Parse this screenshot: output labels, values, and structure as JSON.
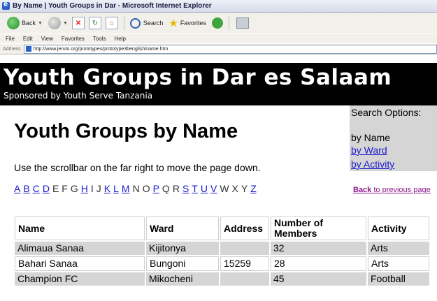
{
  "window": {
    "title": "By Name | Youth Groups in Dar - Microsoft Internet Explorer"
  },
  "toolbar": {
    "back_label": "Back",
    "search_label": "Search",
    "favorites_label": "Favorites"
  },
  "menu": [
    "File",
    "Edit",
    "View",
    "Favorites",
    "Tools",
    "Help"
  ],
  "address": {
    "label": "Address",
    "url": "http://www.jeruto.org/prototypes/prototype3benglish/name.htm"
  },
  "banner": {
    "title": "Youth Groups in Dar es Salaam",
    "sponsor": "Sponsored by Youth Serve Tanzania"
  },
  "page": {
    "heading": "Youth Groups by Name",
    "instruction": "Use the scrollbar on the far right to move the page down.",
    "letters": [
      {
        "l": "A",
        "link": true
      },
      {
        "l": "B",
        "link": true
      },
      {
        "l": "C",
        "link": true
      },
      {
        "l": "D",
        "link": true
      },
      {
        "l": "E",
        "link": false
      },
      {
        "l": "F",
        "link": false
      },
      {
        "l": "G",
        "link": false
      },
      {
        "l": "H",
        "link": true
      },
      {
        "l": "I",
        "link": false
      },
      {
        "l": "J",
        "link": false
      },
      {
        "l": "K",
        "link": true
      },
      {
        "l": "L",
        "link": true
      },
      {
        "l": "M",
        "link": true
      },
      {
        "l": "N",
        "link": false
      },
      {
        "l": "O",
        "link": false
      },
      {
        "l": "P",
        "link": true
      },
      {
        "l": "Q",
        "link": false
      },
      {
        "l": "R",
        "link": false
      },
      {
        "l": "S",
        "link": true
      },
      {
        "l": "T",
        "link": true
      },
      {
        "l": "U",
        "link": true
      },
      {
        "l": "V",
        "link": true
      },
      {
        "l": "W",
        "link": false
      },
      {
        "l": "X",
        "link": false
      },
      {
        "l": "Y",
        "link": false
      },
      {
        "l": "Z",
        "link": true
      }
    ]
  },
  "search_options": {
    "title": "Search Options:",
    "current": "by Name",
    "ward_link": "by Ward",
    "activity_link": "by Activity"
  },
  "back": {
    "bold": "Back",
    "rest": " to previous page"
  },
  "table": {
    "headers": [
      "Name",
      "Ward",
      "Address",
      "Number of Members",
      "Activity"
    ],
    "rows": [
      [
        "Alimaua Sanaa",
        "Kijitonya",
        "",
        "32",
        "Arts"
      ],
      [
        "Bahari Sanaa",
        "Bungoni",
        "15259",
        "28",
        "Arts"
      ],
      [
        "Champion FC",
        "Mikocheni",
        "",
        "45",
        "Football"
      ]
    ]
  }
}
